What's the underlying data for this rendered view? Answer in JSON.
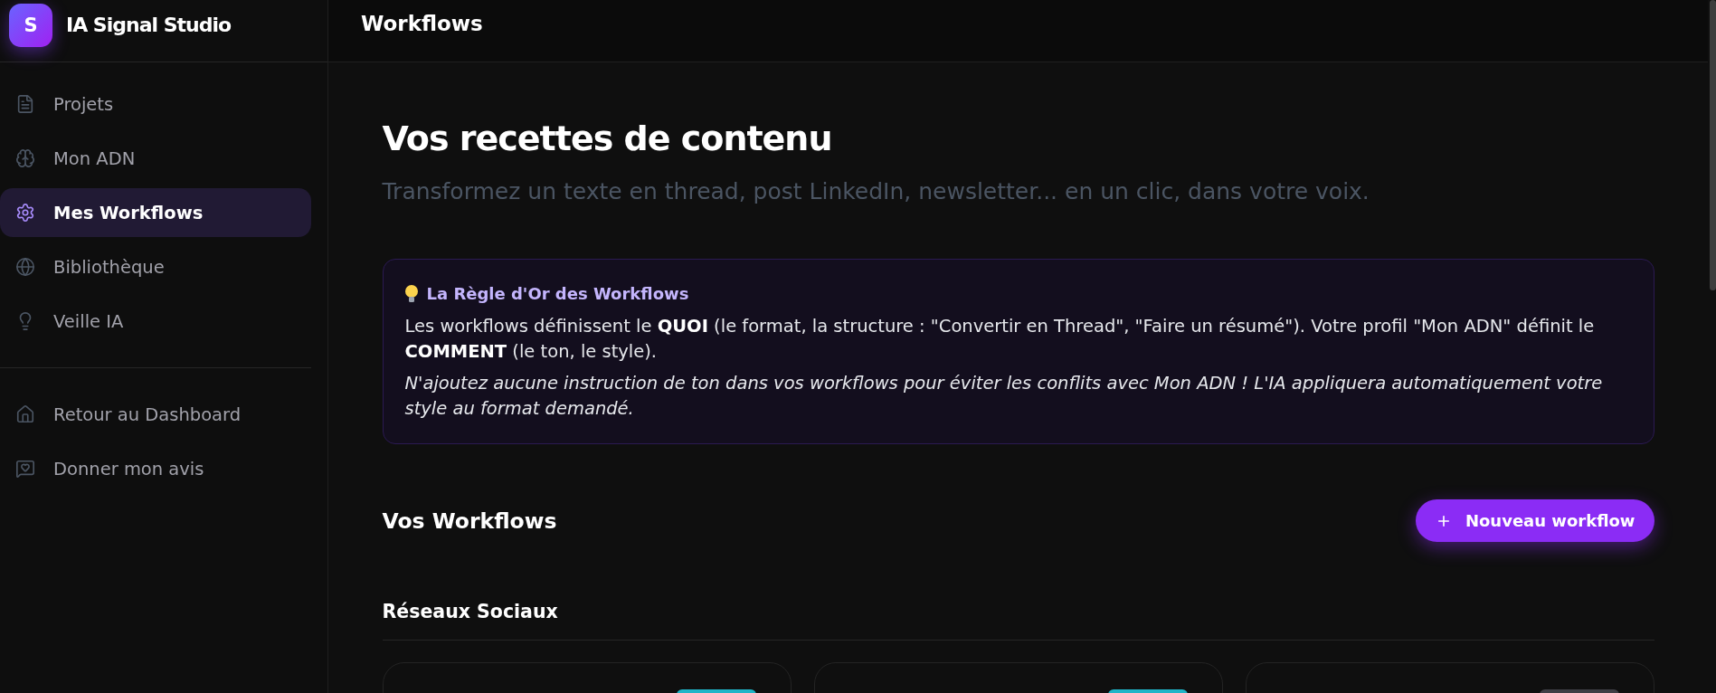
{
  "sidebar": {
    "logo": "S",
    "brand": "IA Signal Studio",
    "nav": [
      {
        "label": "Projets",
        "selected": false
      },
      {
        "label": "Mon ADN",
        "selected": false
      },
      {
        "label": "Mes Workflows",
        "selected": true
      },
      {
        "label": "Bibliothèque",
        "selected": false
      },
      {
        "label": "Veille IA",
        "selected": false
      }
    ],
    "footer_links": [
      {
        "label": "Retour au Dashboard"
      },
      {
        "label": "Donner mon avis"
      }
    ]
  },
  "header": {
    "title": "Workflows"
  },
  "hero": {
    "title": "Vos recettes de contenu",
    "subtitle": "Transformez un texte en thread, post LinkedIn, newsletter... en un clic, dans votre voix."
  },
  "tip": {
    "title": "La Règle d'Or des Workflows",
    "text": "Les workflows définissent le **QUOI** (le format, la structure : \"Convertir en Thread\", \"Faire un résumé\"). Votre profil \"Mon ADN\" définit le **COMMENT** (le ton, le style).",
    "note": "N'ajoutez aucune instruction de ton dans vos workflows pour éviter les conflits avec Mon ADN ! L'IA appliquera automatiquement votre style au format demandé."
  },
  "workflows": {
    "title": "Vos Workflows",
    "new_button": "Nouveau workflow",
    "sections": [
      {
        "title": "Réseaux Sociaux",
        "cards": [
          {
            "color": "#1fb5c8"
          },
          {
            "color": "#1fb5c8"
          },
          {
            "color": "#3f3f46"
          }
        ]
      }
    ]
  }
}
